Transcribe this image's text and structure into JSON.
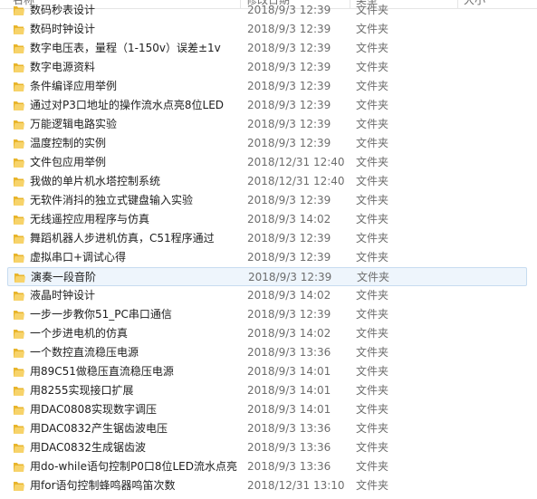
{
  "header": {
    "name_label": "名称",
    "date_label": "修改日期",
    "type_label": "类型",
    "size_label": "大小"
  },
  "icon": "folder-icon",
  "colors": {
    "folder_body": "#e8b52c",
    "folder_front": "#f7d36a",
    "selection_bg": "#eef5fc",
    "selection_border": "#c7dcf0"
  },
  "selected_index": 14,
  "rows": [
    {
      "name": "数码秒表设计",
      "date": "2018/9/3 12:39",
      "type": "文件夹"
    },
    {
      "name": "数码时钟设计",
      "date": "2018/9/3 12:39",
      "type": "文件夹"
    },
    {
      "name": "数字电压表，量程（1-150v）误差±1v",
      "date": "2018/9/3 12:39",
      "type": "文件夹"
    },
    {
      "name": "数字电源资料",
      "date": "2018/9/3 12:39",
      "type": "文件夹"
    },
    {
      "name": "条件编译应用举例",
      "date": "2018/9/3 12:39",
      "type": "文件夹"
    },
    {
      "name": "通过对P3口地址的操作流水点亮8位LED",
      "date": "2018/9/3 12:39",
      "type": "文件夹"
    },
    {
      "name": "万能逻辑电路实验",
      "date": "2018/9/3 12:39",
      "type": "文件夹"
    },
    {
      "name": "温度控制的实例",
      "date": "2018/9/3 12:39",
      "type": "文件夹"
    },
    {
      "name": "文件包应用举例",
      "date": "2018/12/31 12:40",
      "type": "文件夹"
    },
    {
      "name": "我做的单片机水塔控制系统",
      "date": "2018/12/31 12:40",
      "type": "文件夹"
    },
    {
      "name": "无软件消抖的独立式键盘输入实验",
      "date": "2018/9/3 12:39",
      "type": "文件夹"
    },
    {
      "name": "无线遥控应用程序与仿真",
      "date": "2018/9/3 14:02",
      "type": "文件夹"
    },
    {
      "name": "舞蹈机器人步进机仿真，C51程序通过",
      "date": "2018/9/3 12:39",
      "type": "文件夹"
    },
    {
      "name": "虚拟串口+调试心得",
      "date": "2018/9/3 12:39",
      "type": "文件夹"
    },
    {
      "name": "演奏一段音阶",
      "date": "2018/9/3 12:39",
      "type": "文件夹"
    },
    {
      "name": "液晶时钟设计",
      "date": "2018/9/3 14:02",
      "type": "文件夹"
    },
    {
      "name": "一步一步教你51_PC串口通信",
      "date": "2018/9/3 12:39",
      "type": "文件夹"
    },
    {
      "name": "一个步进电机的仿真",
      "date": "2018/9/3 14:02",
      "type": "文件夹"
    },
    {
      "name": "一个数控直流稳压电源",
      "date": "2018/9/3 13:36",
      "type": "文件夹"
    },
    {
      "name": "用89C51做稳压直流稳压电源",
      "date": "2018/9/3 14:01",
      "type": "文件夹"
    },
    {
      "name": "用8255实现接口扩展",
      "date": "2018/9/3 14:01",
      "type": "文件夹"
    },
    {
      "name": "用DAC0808实现数字调压",
      "date": "2018/9/3 14:01",
      "type": "文件夹"
    },
    {
      "name": "用DAC0832产生锯齿波电压",
      "date": "2018/9/3 13:36",
      "type": "文件夹"
    },
    {
      "name": "用DAC0832生成锯齿波",
      "date": "2018/9/3 13:36",
      "type": "文件夹"
    },
    {
      "name": "用do-while语句控制P0口8位LED流水点亮",
      "date": "2018/9/3 13:36",
      "type": "文件夹"
    },
    {
      "name": "用for语句控制蜂鸣器鸣笛次数",
      "date": "2018/12/31 13:10",
      "type": "文件夹"
    }
  ]
}
